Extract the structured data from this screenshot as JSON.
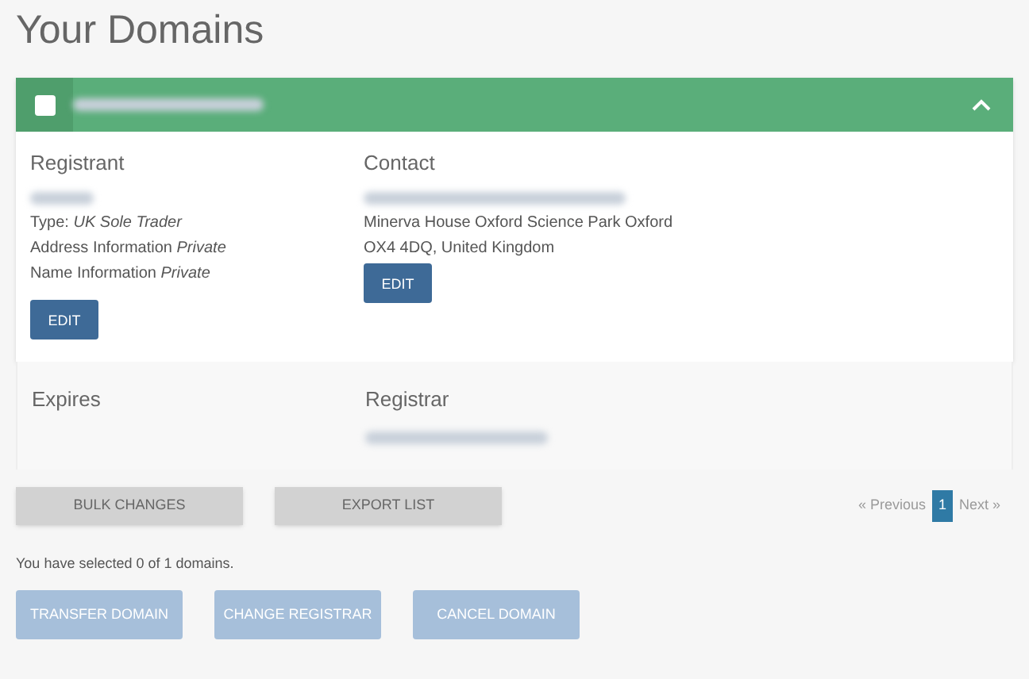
{
  "title": "Your Domains",
  "domain": {
    "checked": false,
    "expanded": true,
    "registrant": {
      "heading": "Registrant",
      "lines": [
        "Type: *UK Sole Trader*",
        "Address Information *Private*",
        "Name Information *Private*"
      ],
      "button": "EDIT"
    },
    "contact": {
      "heading": "Contact",
      "lines": [
        "Minerva House Oxford Science Park Oxford",
        "OX4 4DQ, United Kingdom"
      ],
      "button": "EDIT"
    },
    "expires": {
      "heading": "Expires"
    },
    "registrar": {
      "heading": "Registrar"
    }
  },
  "actions": [
    "BULK CHANGES",
    "EXPORT LIST"
  ],
  "pagination": {
    "previous": "« Previous",
    "next": "Next »",
    "pages": [
      {
        "label": "1",
        "selected": true
      }
    ]
  },
  "selection_text": "You have selected 0 of 1 domains.",
  "bulk_buttons": [
    {
      "label": "TRANSFER DOMAIN",
      "disabled": true
    },
    {
      "label": "CHANGE REGISTRAR",
      "disabled": true
    },
    {
      "label": "CANCEL DOMAIN",
      "disabled": true
    }
  ]
}
